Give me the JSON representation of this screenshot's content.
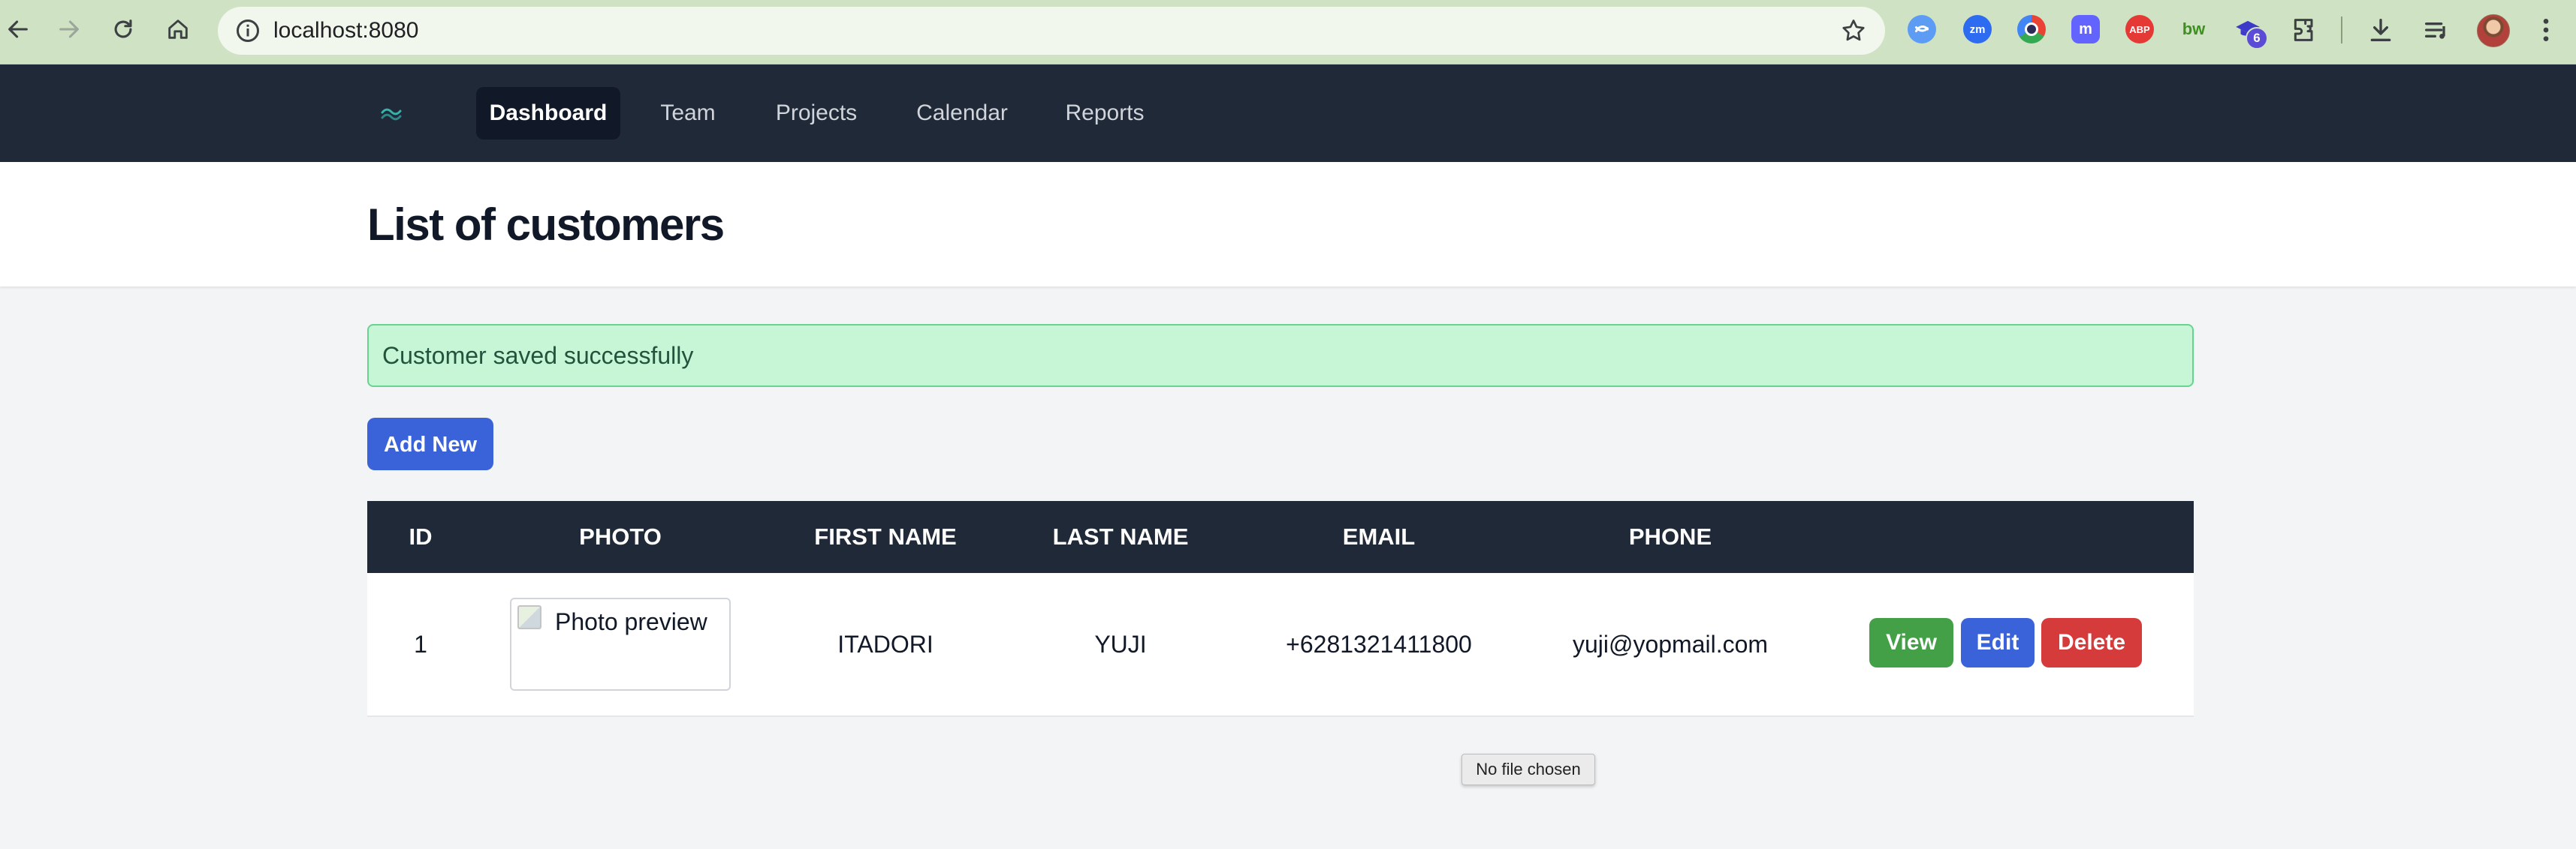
{
  "browser": {
    "url": "localhost:8080",
    "extensions": [
      {
        "name": "blue-swirl-extension-icon",
        "color": "#4f8ef7"
      },
      {
        "name": "zoom-extension-icon",
        "label": "zm",
        "color": "#2d6bf0"
      },
      {
        "name": "circle-extension-icon",
        "color": "#6b4fd0"
      },
      {
        "name": "mastodon-extension-icon",
        "color": "#6364ff"
      },
      {
        "name": "adblock-plus-extension-icon",
        "label": "ABP",
        "color": "#e53935"
      },
      {
        "name": "bw-extension-icon",
        "label": "bw",
        "color": "#3f8f22"
      },
      {
        "name": "graduation-cap-extension-icon",
        "badge": "6",
        "color": "#3d3ac9"
      }
    ]
  },
  "appnav": {
    "items": [
      {
        "label": "Dashboard",
        "active": true
      },
      {
        "label": "Team"
      },
      {
        "label": "Projects"
      },
      {
        "label": "Calendar"
      },
      {
        "label": "Reports"
      }
    ]
  },
  "page": {
    "title": "List of customers"
  },
  "alert": {
    "message": "Customer saved successfully"
  },
  "actions": {
    "add_new": "Add New"
  },
  "table": {
    "headers": [
      "ID",
      "PHOTO",
      "FIRST NAME",
      "LAST NAME",
      "EMAIL",
      "PHONE"
    ],
    "rows": [
      {
        "id": "1",
        "photo_alt": "Photo preview",
        "first_name": "ITADORI",
        "last_name": "YUJI",
        "email": "+6281321411800",
        "phone": "yuji@yopmail.com",
        "buttons": {
          "view": "View",
          "edit": "Edit",
          "delete": "Delete"
        }
      }
    ]
  },
  "tooltip": {
    "text": "No file chosen"
  },
  "colors": {
    "navbar": "#1f2937",
    "primary": "#3b63d9",
    "success": "#43a047",
    "danger": "#d63b3b",
    "alert_bg": "#c6f6d5"
  }
}
